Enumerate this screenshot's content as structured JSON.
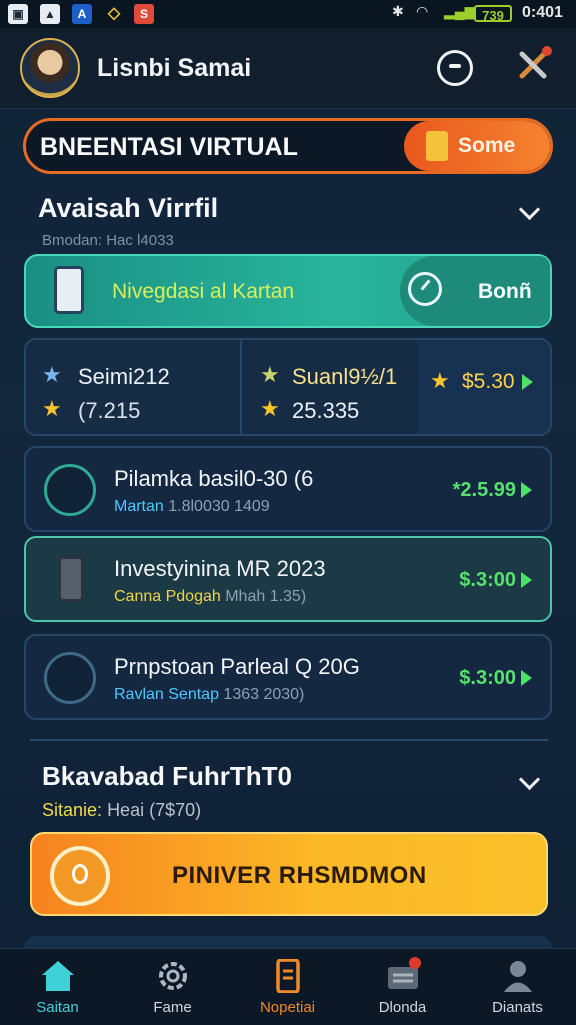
{
  "status_bar": {
    "battery": "739",
    "time": "0:401"
  },
  "header": {
    "user_name": "Lisnbi Samai"
  },
  "hero": {
    "title": "BNEENTASI VIRTUAL",
    "button_label": "Some"
  },
  "section1": {
    "title": "Avaisah Virrfil",
    "subtitle": "Bmodan: Hac l4033"
  },
  "green_card": {
    "label": "Nivegdasi al Kartan",
    "button_label": "Bonñ"
  },
  "stats": {
    "col1": {
      "value1": "Seimi212",
      "value2": "(7.215"
    },
    "col2": {
      "value1": "Suanl9½/1",
      "value2": "25.335"
    },
    "col3": {
      "value1": "$5.30"
    }
  },
  "rows": [
    {
      "title": "Pilamka basil0-30 (6",
      "sub_highlight": "Martan",
      "sub_rest": "1.8l0030 1409",
      "amount": "*2.5.99"
    },
    {
      "title": "Investyinina MR 2023",
      "sub_highlight": "Canna Pdogah",
      "sub_rest": "Mhah 1.35)",
      "amount": "$.3:00"
    },
    {
      "title": "Prnpstoan Parleal Q 20G",
      "sub_highlight": "Ravlan Sentap",
      "sub_rest": "1363 2030)",
      "amount": "$.3:00"
    }
  ],
  "section2": {
    "title": "Bkavabad FuhrThT0",
    "subtitle_label": "Sitanie:",
    "subtitle_value": "Heai (7$70)"
  },
  "cta": {
    "label": "PINIVER RHSMDMON"
  },
  "nav": [
    {
      "label": "Saitan",
      "state": "active"
    },
    {
      "label": "Fame",
      "state": "normal"
    },
    {
      "label": "Nopetiai",
      "state": "hot"
    },
    {
      "label": "Dlonda",
      "state": "normal"
    },
    {
      "label": "Dianats",
      "state": "normal"
    }
  ],
  "colors": {
    "accent_orange": "#e66a24",
    "accent_green": "#56e06d",
    "accent_teal": "#29b59c",
    "background": "#13273d"
  }
}
